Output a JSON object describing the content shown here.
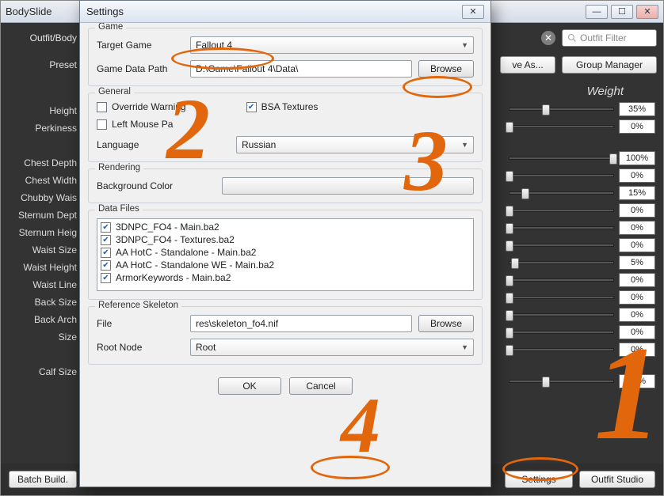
{
  "main": {
    "title": "BodySlide",
    "outfit_body_label": "Outfit/Body",
    "preset_label": "Preset",
    "save_as_label": "ve As...",
    "group_manager_label": "Group Manager",
    "outfit_filter_placeholder": "Outfit Filter",
    "weight_header": "Weight",
    "bottom": {
      "batch_build": "Batch Build.",
      "settings": "Settings",
      "outfit_studio": "Outfit Studio"
    }
  },
  "left_labels": [
    "Height",
    "Perkiness",
    "",
    "Chest Depth",
    "Chest Width",
    "Chubby Wais",
    "Sternum Dept",
    "Sternum Heig",
    "Waist Size",
    "Waist Height",
    "Waist Line",
    "Back Size",
    "Back Arch",
    "Size",
    "",
    "Calf Size"
  ],
  "sliders": [
    {
      "value": "35%",
      "pos": 35
    },
    {
      "value": "0%",
      "pos": 0
    },
    {
      "value": "100%",
      "pos": 100
    },
    {
      "value": "0%",
      "pos": 0
    },
    {
      "value": "15%",
      "pos": 15
    },
    {
      "value": "0%",
      "pos": 0
    },
    {
      "value": "0%",
      "pos": 0
    },
    {
      "value": "0%",
      "pos": 0
    },
    {
      "value": "5%",
      "pos": 5
    },
    {
      "value": "0%",
      "pos": 0
    },
    {
      "value": "0%",
      "pos": 0
    },
    {
      "value": "0%",
      "pos": 0
    },
    {
      "value": "0%",
      "pos": 0
    },
    {
      "value": "0%",
      "pos": 0
    },
    {
      "value": "35%",
      "pos": 35
    }
  ],
  "dialog": {
    "title": "Settings",
    "groups": {
      "game": "Game",
      "general": "General",
      "rendering": "Rendering",
      "data_files": "Data Files",
      "ref_skel": "Reference Skeleton"
    },
    "game": {
      "target_label": "Target Game",
      "target_value": "Fallout 4",
      "path_label": "Game Data Path",
      "path_value": "D:\\Game\\Fallout 4\\Data\\",
      "browse": "Browse"
    },
    "general": {
      "override": "Override Warning",
      "leftmouse": "Left Mouse Pa",
      "bsa": "BSA Textures",
      "language_label": "Language",
      "language_value": "Russian"
    },
    "rendering": {
      "bg_label": "Background Color"
    },
    "files": [
      "3DNPC_FO4 - Main.ba2",
      "3DNPC_FO4 - Textures.ba2",
      "AA HotC - Standalone - Main.ba2",
      "AA HotC - Standalone WE - Main.ba2",
      "ArmorKeywords - Main.ba2"
    ],
    "skel": {
      "file_label": "File",
      "file_value": "res\\skeleton_fo4.nif",
      "browse": "Browse",
      "root_label": "Root Node",
      "root_value": "Root"
    },
    "ok": "OK",
    "cancel": "Cancel"
  },
  "annotations": {
    "n1": "1",
    "n2": "2",
    "n3": "3",
    "n4": "4"
  }
}
